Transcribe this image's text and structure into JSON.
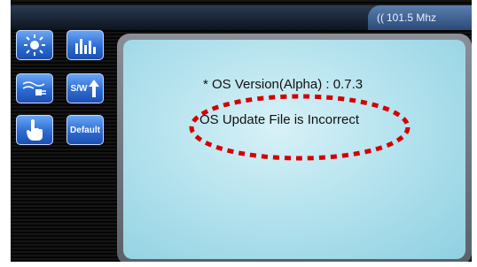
{
  "status_bar": {
    "radio_frequency": "101.5 Mhz"
  },
  "side_buttons": {
    "sw_label": "S/W",
    "default_label": "Default"
  },
  "dialog": {
    "os_version_line": "* OS Version(Alpha) : 0.7.3",
    "message": "OS Update File is Incorrect"
  },
  "colors": {
    "highlight": "#d40000",
    "button_blue": "#2d6bd1",
    "panel_bg": "#b5e3ee"
  }
}
